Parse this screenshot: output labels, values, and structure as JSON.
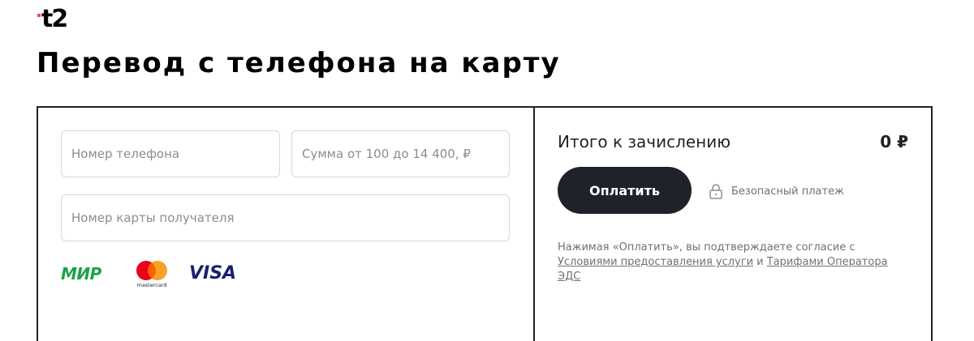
{
  "brand": {
    "logo_text": "t2",
    "accent_color": "#ff3495"
  },
  "page": {
    "title": "Перевод с телефона на карту"
  },
  "form": {
    "phone_placeholder": "Номер телефона",
    "sum_placeholder": "Сумма от 100 до 14 400, ₽",
    "card_placeholder": "Номер карты получателя",
    "payment_systems": [
      "МИР",
      "mastercard",
      "VISA"
    ]
  },
  "summary": {
    "total_label": "Итого к зачислению",
    "total_value": "0 ₽",
    "pay_button": "Оплатить",
    "secure_label": "Безопасный платеж",
    "secure_icon": "lock-icon",
    "terms_prefix": "Нажимая «Оплатить», вы подтверждаете согласие с",
    "terms_link1": "Условиями предоставления услуги",
    "terms_and": "и",
    "terms_link2": "Тарифами Оператора",
    "terms_suffix": "ЭДС"
  },
  "colors": {
    "button_bg": "#1f2229",
    "mir_green": "#1aa34a",
    "visa_blue": "#1a1f71",
    "mc_red": "#eb001b",
    "mc_orange": "#f79e1b"
  }
}
